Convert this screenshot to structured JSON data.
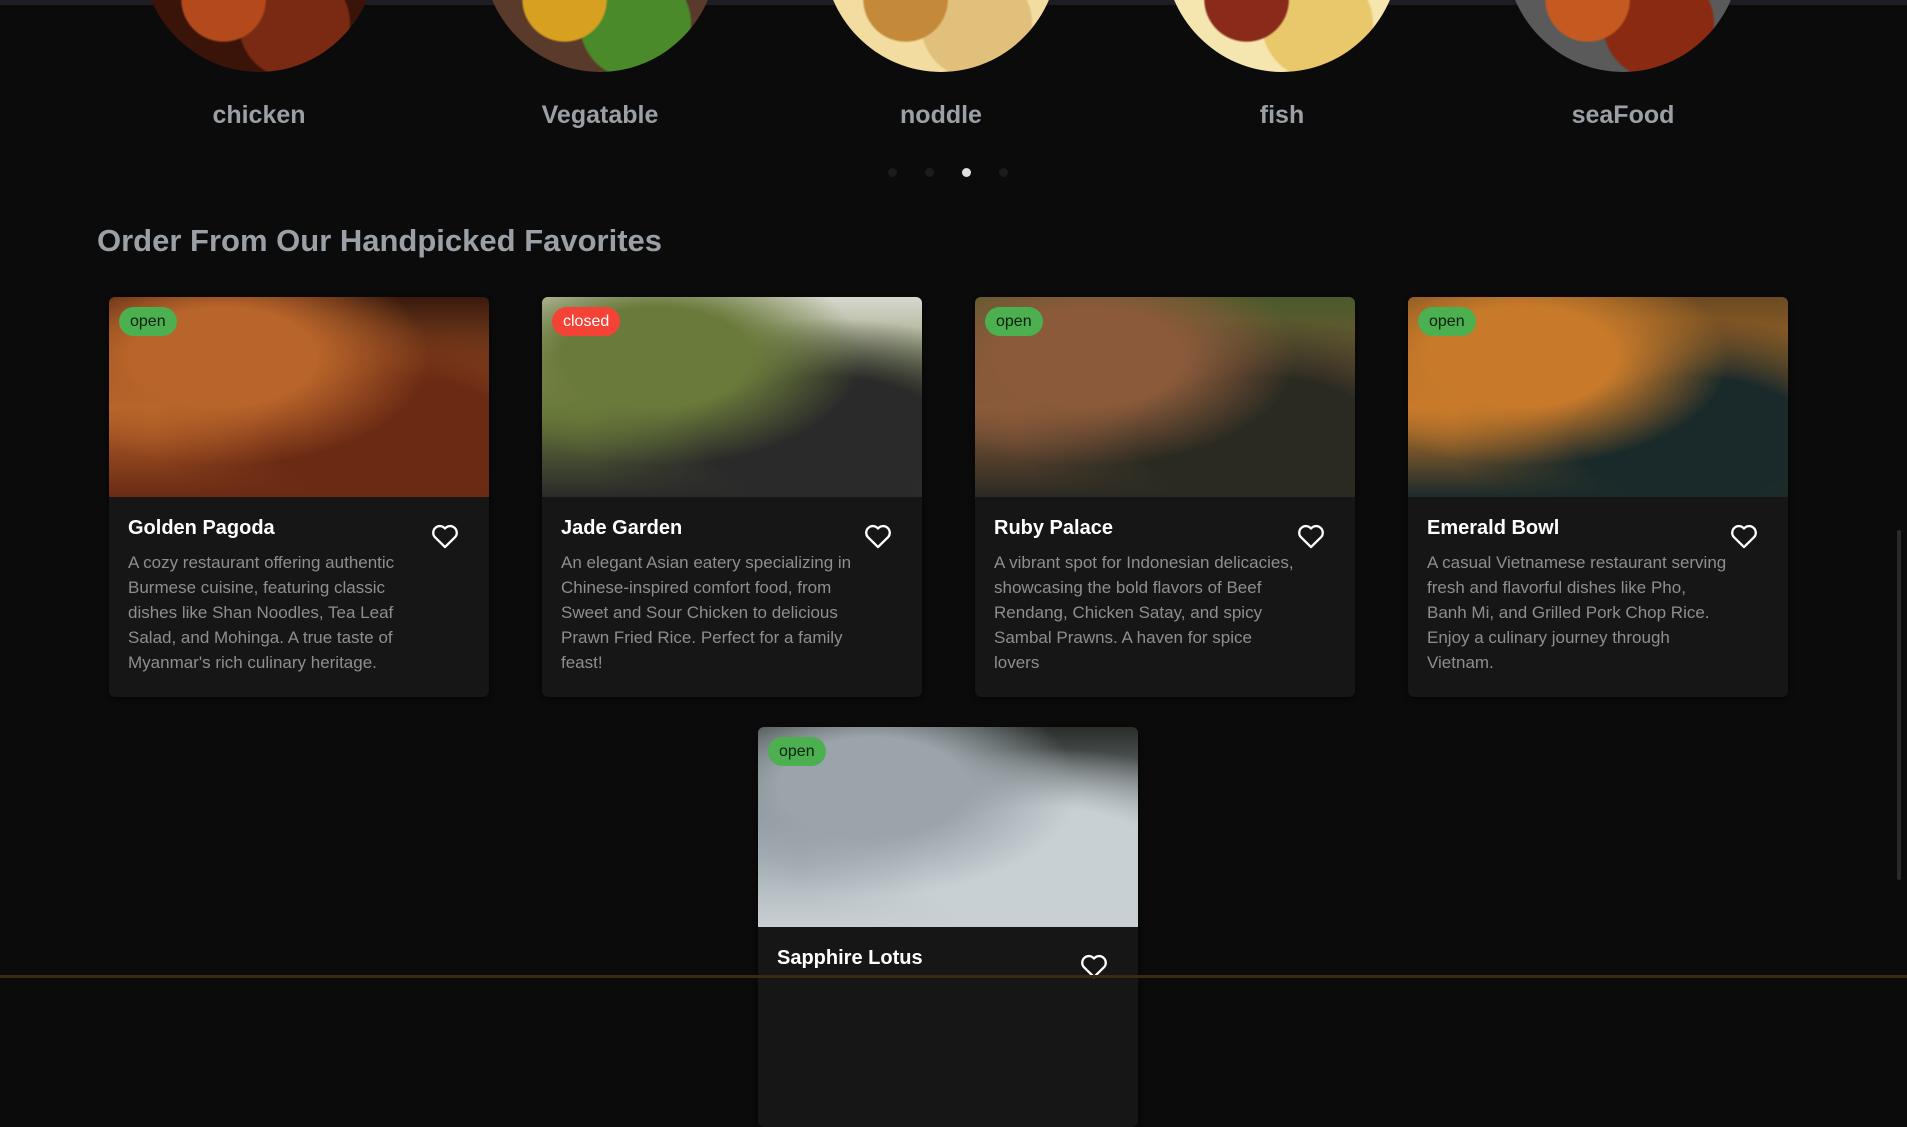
{
  "categories": [
    {
      "label": "chicken",
      "colors": [
        "#7a2a12",
        "#b44a1c",
        "#3a1408"
      ]
    },
    {
      "label": "Vegatable",
      "colors": [
        "#4a8a2a",
        "#d8a020",
        "#5a3a2a"
      ]
    },
    {
      "label": "noddle",
      "colors": [
        "#e0c07a",
        "#c48a3a",
        "#f3dca0"
      ]
    },
    {
      "label": "fish",
      "colors": [
        "#e8c86a",
        "#8a2a1a",
        "#f5e6b0"
      ]
    },
    {
      "label": "seaFood",
      "colors": [
        "#8a2a12",
        "#c45a20",
        "#5a5a5a"
      ]
    }
  ],
  "carousel": {
    "pages": 4,
    "active_index": 2
  },
  "section_title": "Order From Our Handpicked Favorites",
  "restaurants": [
    {
      "name": "Golden Pagoda",
      "status": "open",
      "description": "A cozy restaurant offering authentic Burmese cuisine, featuring classic dishes like Shan Noodles, Tea Leaf Salad, and Mohinga. A true taste of Myanmar's rich culinary heritage.",
      "photo_colors": [
        "#3a1a0e",
        "#b8642a",
        "#6a2a14"
      ]
    },
    {
      "name": "Jade Garden",
      "status": "closed",
      "description": "An elegant Asian eatery specializing in Chinese-inspired comfort food, from Sweet and Sour Chicken to delicious Prawn Fried Rice. Perfect for a family feast!",
      "photo_colors": [
        "#d8d8d0",
        "#6a7a3a",
        "#2a2a2a"
      ]
    },
    {
      "name": "Ruby Palace",
      "status": "open",
      "description": "A vibrant spot for Indonesian delicacies, showcasing the bold flavors of Beef Rendang, Chicken Satay, and spicy Sambal Prawns. A haven for spice lovers",
      "photo_colors": [
        "#4a5a2a",
        "#8a5a3a",
        "#2a2a22"
      ]
    },
    {
      "name": "Emerald Bowl",
      "status": "open",
      "description": "A casual Vietnamese restaurant serving fresh and flavorful dishes like Pho, Banh Mi, and Grilled Pork Chop Rice. Enjoy a culinary journey through Vietnam.",
      "photo_colors": [
        "#6a4a22",
        "#c87a2a",
        "#1a2a2a"
      ]
    },
    {
      "name": "Sapphire Lotus",
      "status": "open",
      "description": "",
      "photo_colors": [
        "#2a2e2a",
        "#9aa4aa",
        "#c8d0d4"
      ]
    }
  ],
  "icons": {
    "favorite": "heart-outline-icon"
  },
  "colors": {
    "open": "#4caf50",
    "closed": "#f44336",
    "background": "#0b0b0b",
    "card": "#161616"
  }
}
